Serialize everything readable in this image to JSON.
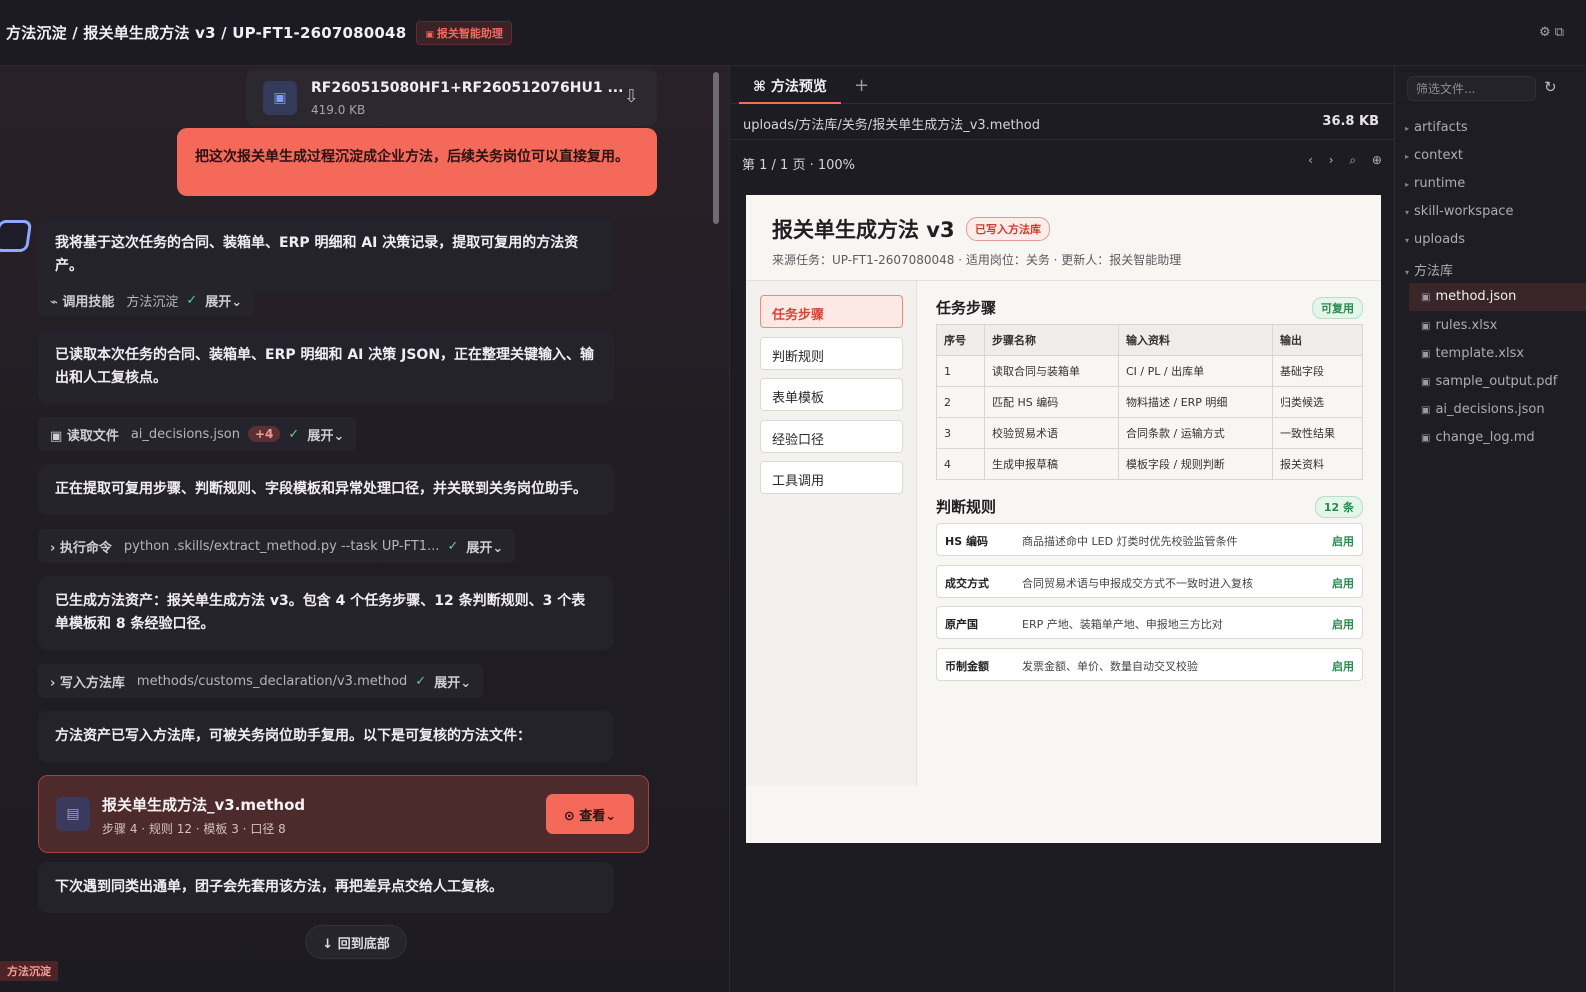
{
  "header": {
    "breadcrumb": "方法沉淀 / 报关单生成方法 v3 / UP-FT1-2607080048",
    "agent_tag": "报关智能助理",
    "agent_icon": "square-icon",
    "settings_icon": "gear-icon",
    "window_icon": "copy-icon"
  },
  "chat": {
    "attachment": {
      "name": "RF260515080HF1+RF260512076HU1 ...",
      "size": "419.0 KB"
    },
    "user_message": "把这次报关单生成过程沉淀成企业方法，后续关务岗位可以直接复用。",
    "messages": [
      "我将基于这次任务的合同、装箱单、ERP 明细和 AI 决策记录，提取可复用的方法资产。",
      "已读取本次任务的合同、装箱单、ERP 明细和 AI 决策 JSON，正在整理关键输入、输出和人工复核点。",
      "正在提取可复用步骤、判断规则、字段模板和异常处理口径，并关联到关务岗位助手。",
      "已生成方法资产：报关单生成方法 v3。包含 4 个任务步骤、12 条判断规则、3 个表单模板和 8 条经验口径。",
      "方法资产已写入方法库，可被关务岗位助手复用。以下是可复核的方法文件：",
      "下次遇到同类出通单，团子会先套用该方法，再把差异点交给人工复核。"
    ],
    "tools": [
      {
        "prefix": "⌁",
        "label": "调用技能",
        "arg": "方法沉淀",
        "check": "✓",
        "expand": "展开⌄"
      },
      {
        "prefix": "▣",
        "label": "读取文件",
        "arg": "ai_decisions.json",
        "count": "+4",
        "check": "✓",
        "expand": "展开⌄"
      },
      {
        "prefix": "›",
        "label": "执行命令",
        "arg": "python .skills/extract_method.py --task UP-FT1...",
        "check": "✓",
        "expand": "展开⌄"
      },
      {
        "prefix": "›",
        "label": "写入方法库",
        "arg": "methods/customs_declaration/v3.method",
        "check": "✓",
        "expand": "展开⌄"
      }
    ],
    "method_card": {
      "title": "报关单生成方法_v3.method",
      "meta": "步骤 4 · 规则 12 · 模板 3 · 口径 8",
      "view_button": "⊙ 查看⌄"
    },
    "back_to_bottom": "↓ 回到底部",
    "status_tag": "方法沉淀"
  },
  "preview": {
    "tab_label": "⌘ 方法预览",
    "add_tab": "+",
    "path": "uploads/方法库/关务/报关单生成方法_v3.method",
    "file_size": "36.8 KB",
    "page_info": "第 1 / 1 页 · 100%",
    "nav_controls": "‹ › ⌕ ⊕",
    "doc": {
      "title": "报关单生成方法 v3",
      "status_tag": "已写入方法库",
      "meta": "来源任务：UP-FT1-2607080048 · 适用岗位：关务 · 更新人：报关智能助理",
      "side_items": [
        "任务步骤",
        "判断规则",
        "表单模板",
        "经验口径",
        "工具调用"
      ],
      "steps_title": "任务步骤",
      "steps_badge": "可复用",
      "steps_headers": [
        "序号",
        "步骤名称",
        "输入资料",
        "输出"
      ],
      "steps_rows": [
        [
          "1",
          "读取合同与装箱单",
          "CI / PL / 出库单",
          "基础字段"
        ],
        [
          "2",
          "匹配 HS 编码",
          "物料描述 / ERP 明细",
          "归类候选"
        ],
        [
          "3",
          "校验贸易术语",
          "合同条款 / 运输方式",
          "一致性结果"
        ],
        [
          "4",
          "生成申报草稿",
          "模板字段 / 规则判断",
          "报关资料"
        ]
      ],
      "rules_title": "判断规则",
      "rules_badge": "12 条",
      "rules": [
        {
          "key": "HS 编码",
          "desc": "商品描述命中 LED 灯类时优先校验监管条件",
          "status": "启用"
        },
        {
          "key": "成交方式",
          "desc": "合同贸易术语与申报成交方式不一致时进入复核",
          "status": "启用"
        },
        {
          "key": "原产国",
          "desc": "ERP 产地、装箱单产地、申报地三方比对",
          "status": "启用"
        },
        {
          "key": "币制金额",
          "desc": "发票金额、单价、数量自动交叉校验",
          "status": "启用"
        }
      ]
    }
  },
  "tree": {
    "filter_placeholder": "筛选文件...",
    "refresh_icon": "↻",
    "folders": [
      "artifacts",
      "context",
      "runtime",
      "skill-workspace",
      "uploads",
      "方法库"
    ],
    "files": [
      "method.json",
      "rules.xlsx",
      "template.xlsx",
      "sample_output.pdf",
      "ai_decisions.json",
      "change_log.md"
    ],
    "selected_file": "method.json"
  }
}
